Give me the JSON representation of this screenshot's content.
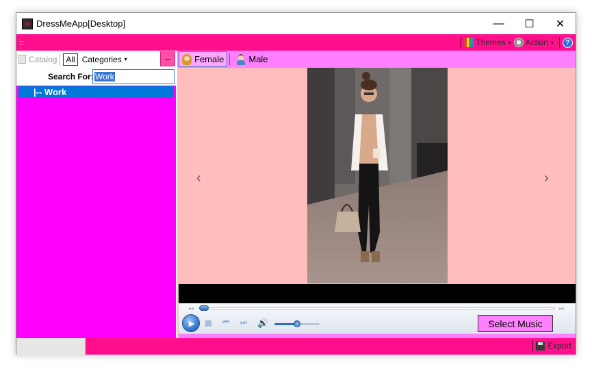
{
  "window": {
    "title": "DressMeApp[Desktop]",
    "controls": {
      "minimize": "—",
      "maximize": "☐",
      "close": "✕"
    }
  },
  "toolbar": {
    "grip": "::::",
    "themes_label": "Themes",
    "action_label": "Action",
    "help_glyph": "?",
    "caret": "▾",
    "background": "#ff0f8c"
  },
  "left_panel": {
    "catalog_label": "Catalog",
    "all_label": "All",
    "categories_label": "Categories",
    "collapse_glyph": "–",
    "search_label": "Search For:",
    "search_value": "Work",
    "tree": [
      {
        "label": "|-- Work",
        "selected": true
      }
    ],
    "background": "#ff00ff"
  },
  "gender_tabs": [
    {
      "label": "Female",
      "active": true
    },
    {
      "label": "Male",
      "active": false
    }
  ],
  "viewer": {
    "prev_arrow": "‹",
    "next_arrow": "›",
    "background": "#ffbdbd"
  },
  "player": {
    "play_glyph": "▶",
    "prev_glyph": "⏮",
    "next_glyph": "⏭",
    "volume_glyph": "🔊",
    "seek_left_glyph": "◂◂",
    "seek_right_glyph": "▸▸",
    "volume_level": 0.5,
    "select_music_label": "Select Music"
  },
  "statusbar": {
    "export_label": "Export"
  }
}
